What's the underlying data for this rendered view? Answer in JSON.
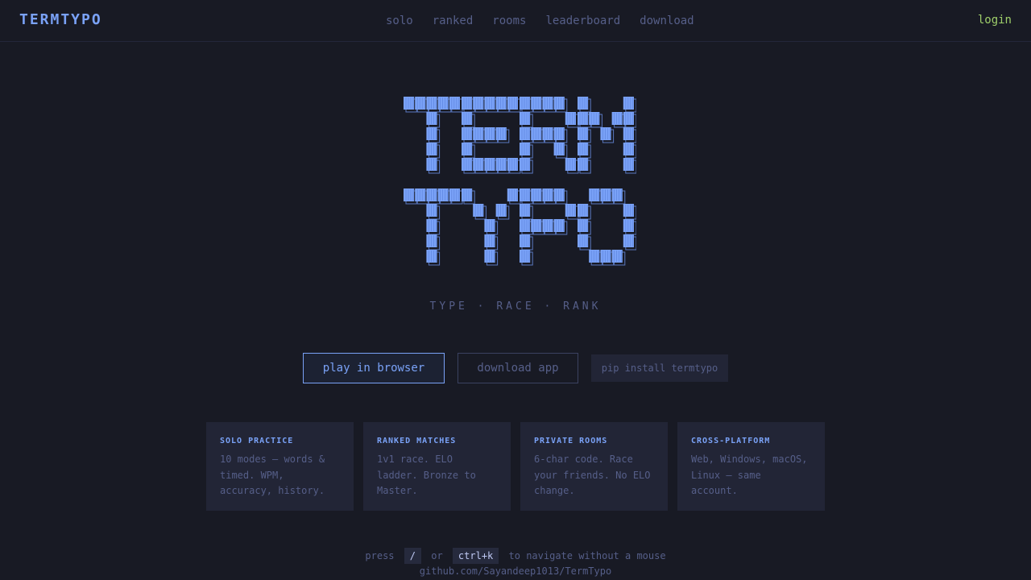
{
  "header": {
    "brand": "TERMTYPO",
    "nav": [
      "solo",
      "ranked",
      "rooms",
      "leaderboard",
      "download"
    ],
    "login": "login"
  },
  "hero": {
    "tagline": "TYPE · RACE · RANK",
    "buttons": {
      "play": "play in browser",
      "download": "download app"
    },
    "pip": "pip install termtypo"
  },
  "features": [
    {
      "title": "SOLO PRACTICE",
      "desc": "10 modes — words & timed. WPM, accuracy, history."
    },
    {
      "title": "RANKED MATCHES",
      "desc": "1v1 race. ELO ladder. Bronze to Master."
    },
    {
      "title": "PRIVATE ROOMS",
      "desc": "6-char code. Race your friends. No ELO change."
    },
    {
      "title": "CROSS-PLATFORM",
      "desc": "Web, Windows, macOS, Linux — same account."
    }
  ],
  "footer": {
    "press": "press",
    "key1": "/",
    "or": "or",
    "key2": "ctrl+k",
    "hint_tail": "to navigate without a mouse",
    "repo": "github.com/Sayandeep1013/TermTypo"
  },
  "colors": {
    "background": "#181a24",
    "accent": "#7aa2f7",
    "muted": "#565f89",
    "login": "#9ece6a",
    "card": "#222536"
  }
}
